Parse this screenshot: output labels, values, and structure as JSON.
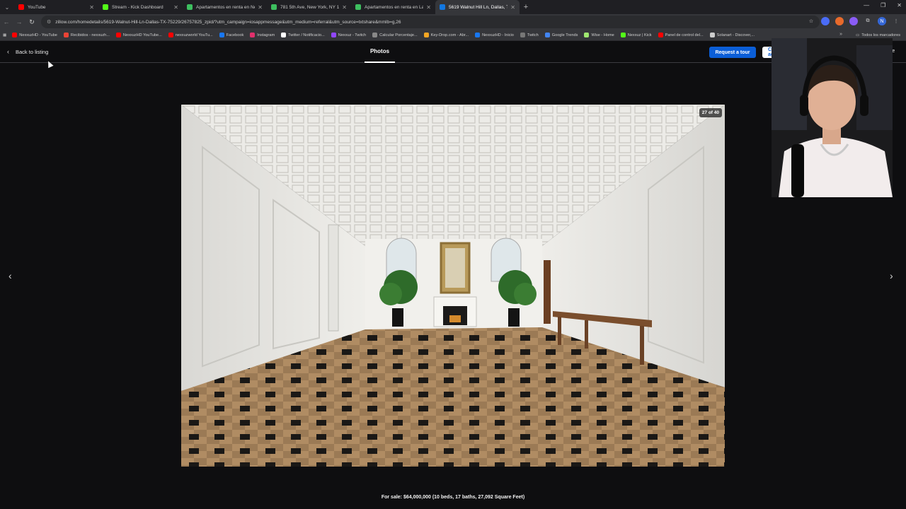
{
  "browser": {
    "tabs": [
      {
        "title": "YouTube",
        "color": "#ff0000",
        "active": false
      },
      {
        "title": "Stream - Kick Dashboard",
        "color": "#53fc18",
        "active": false
      },
      {
        "title": "Apartamentos en renta en New",
        "color": "#3dbf5f",
        "active": false
      },
      {
        "title": "781 5th Ave, New York, NY 100",
        "color": "#3dbf5f",
        "active": false
      },
      {
        "title": "Apartamentos en renta en Las",
        "color": "#3dbf5f",
        "active": false
      },
      {
        "title": "5619 Walnut Hill Ln, Dallas, TX",
        "color": "#1277e1",
        "active": true
      }
    ],
    "url": "zillow.com/homedetails/5619-Walnut-Hill-Ln-Dallas-TX-75229/26757825_zpid/?utm_campaign=iosappmessage&utm_medium=referral&utm_source=txtshare&mmlb=g,26",
    "bookmarks": [
      {
        "label": "NexxuzHD - YouTube",
        "color": "#ff0000"
      },
      {
        "label": "Recibidos - nexxuzh...",
        "color": "#ea4335"
      },
      {
        "label": "NexxuzHD YouTube...",
        "color": "#ff0000"
      },
      {
        "label": "nexxuzworld YouTu...",
        "color": "#ff0000"
      },
      {
        "label": "Facebook",
        "color": "#1877f2"
      },
      {
        "label": "Instagram",
        "color": "#e1306c"
      },
      {
        "label": "Twitter / Notificacio...",
        "color": "#ffffff"
      },
      {
        "label": "Nexxuz - Twitch",
        "color": "#9146ff"
      },
      {
        "label": "Calcular Porcentaje...",
        "color": "#888888"
      },
      {
        "label": "Key-Drop.com - Abr...",
        "color": "#f5a623"
      },
      {
        "label": "NexxuzHD - Inicio",
        "color": "#1877f2"
      },
      {
        "label": "Twitch",
        "color": "#777777"
      },
      {
        "label": "Google Trends",
        "color": "#4285f4"
      },
      {
        "label": "Wise - Home",
        "color": "#9fe870"
      },
      {
        "label": "Nexxuz | Kick",
        "color": "#53fc18"
      },
      {
        "label": "Panel de control del...",
        "color": "#ff0000"
      },
      {
        "label": "Solanart - Discover,...",
        "color": "#cccccc"
      }
    ],
    "all_bookmarks": "Todos los marcadores"
  },
  "header": {
    "back_label": "Back to listing",
    "photos_tab": "Photos",
    "tour_button": "Request a tour",
    "contact_button": "Contact agent",
    "share_button": "re"
  },
  "gallery": {
    "counter": "27 of 40",
    "caption": "For sale: $64,000,000 (10 beds, 17 baths, 27,092 Square Feet)"
  },
  "colors": {
    "accent": "#0b5ed7",
    "background": "#0e0e10"
  }
}
